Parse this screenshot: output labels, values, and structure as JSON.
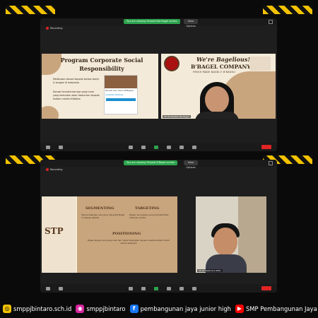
{
  "session1": {
    "share_text": "You are viewing Pelakat Nia Bagel screen",
    "view_options": "View Options",
    "recording": "Recording",
    "slide_left": {
      "title": "Program Corporate Social Responsibility",
      "bullet1": "Melakukan donasi kepada korban banjir & longsor di Indonesia",
      "bullet2": "Donasi tersebut berupa uang tunai yang kemudian akan disalurkan kepada korban melalui Kitabisa",
      "inner_title": "Donasi dari kami (B'Bagel)",
      "inner_caption": "Sahabat Kitabisa"
    },
    "slide_right": {
      "script": "We're Bagelious!",
      "company": "B'BAGEL COMPANY",
      "tagline": "FRESH MADE BAGEL!! B'BAGEL!"
    },
    "cam_label": "5P-02 Pelakat Nia Bagel"
  },
  "session2": {
    "share_text": "You are viewing Pelakat B'Bagel screen",
    "view_options": "View Options",
    "recording": "Recording",
    "slide": {
      "stp": "STP",
      "segmenting": "SEGMENTING",
      "targeting": "TARGETING",
      "seg_body": "Semua kalangan usia yang menyukai Bagel di wilayah Jakarta",
      "tar_body": "Pelajar dan pekerja yang membutuhkan makanan praktis",
      "positioning": "POSITIONING",
      "pos_body": "Bagel dengan rasa yang enak dan harga terjangkau dengan kualitas terbaik untuk semua kalangan"
    },
    "cam_label": "5P-02 Nabindra Rifiki"
  },
  "footer": {
    "website": "smppjbintaro.sch.id",
    "instagram": "smppjbintaro",
    "facebook": "pembangunan jaya junior high",
    "youtube": "SMP Pembangunan Jaya"
  },
  "colors": {
    "accent": "#f2c200",
    "zoom_green": "#2da44e",
    "slide_cream": "#f4ead9",
    "slide_tan": "#c9a57e",
    "brown": "#5b3a22"
  }
}
